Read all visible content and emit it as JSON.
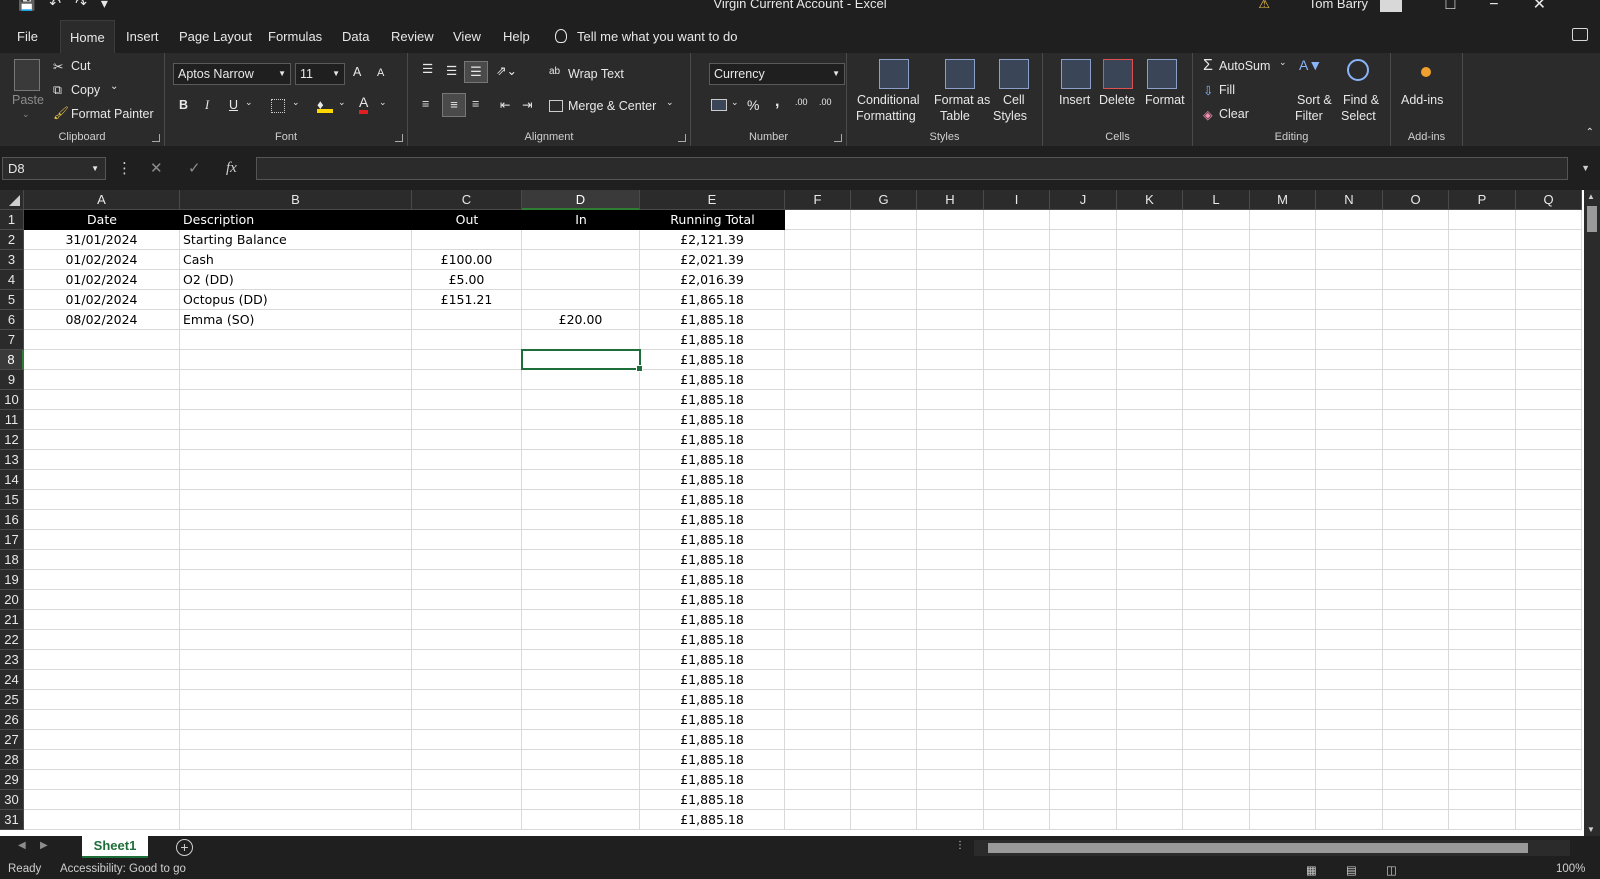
{
  "window": {
    "title": "Virgin Current Account  -  Excel",
    "user": "Tom Barry"
  },
  "menu": {
    "tabs": [
      "File",
      "Home",
      "Insert",
      "Page Layout",
      "Formulas",
      "Data",
      "Review",
      "View",
      "Help"
    ],
    "active": "Home",
    "tell_me": "Tell me what you want to do"
  },
  "ribbon": {
    "clipboard": {
      "label": "Clipboard",
      "paste": "Paste",
      "cut": "Cut",
      "copy": "Copy",
      "format_painter": "Format Painter"
    },
    "font": {
      "label": "Font",
      "name": "Aptos Narrow",
      "size": "11",
      "bold": "B",
      "italic": "I",
      "underline": "U",
      "grow": "A",
      "shrink": "A",
      "font_color_letter": "A"
    },
    "alignment": {
      "label": "Alignment",
      "wrap_text": "Wrap Text",
      "merge_center": "Merge & Center"
    },
    "number": {
      "label": "Number",
      "format": "Currency",
      "percent": "%",
      "comma": ",",
      "inc_dec": ".00",
      "dec_dec": ".00"
    },
    "styles": {
      "label": "Styles",
      "conditional": [
        "Conditional",
        "Formatting"
      ],
      "format_table": [
        "Format as",
        "Table"
      ],
      "cell_styles": [
        "Cell",
        "Styles"
      ]
    },
    "cells": {
      "label": "Cells",
      "insert": "Insert",
      "delete": "Delete",
      "format": "Format"
    },
    "editing": {
      "label": "Editing",
      "autosum": "AutoSum",
      "fill": "Fill",
      "clear": "Clear",
      "sort_filter": [
        "Sort &",
        "Filter"
      ],
      "find_select": [
        "Find &",
        "Select"
      ]
    },
    "addins": {
      "label": "Add-ins",
      "addins": "Add-ins"
    }
  },
  "formula_bar": {
    "name_box": "D8",
    "cancel": "✕",
    "enter": "✓",
    "fx": "fx",
    "value": ""
  },
  "grid": {
    "columns": [
      "A",
      "B",
      "C",
      "D",
      "E",
      "F",
      "G",
      "H",
      "I",
      "J",
      "K",
      "L",
      "M",
      "N",
      "O",
      "P",
      "Q"
    ],
    "selected_column": "D",
    "selected_row": 8,
    "headers": [
      "Date",
      "Description",
      "Out",
      "In",
      "Running Total"
    ],
    "rows": [
      [
        "31/01/2024",
        "Starting Balance",
        "",
        "",
        "£2,121.39"
      ],
      [
        "01/02/2024",
        "Cash",
        "£100.00",
        "",
        "£2,021.39"
      ],
      [
        "01/02/2024",
        "O2 (DD)",
        "£5.00",
        "",
        "£2,016.39"
      ],
      [
        "01/02/2024",
        "Octopus  (DD)",
        "£151.21",
        "",
        "£1,865.18"
      ],
      [
        "08/02/2024",
        "Emma (SO)",
        "",
        "£20.00",
        "£1,885.18"
      ],
      [
        "",
        "",
        "",
        "",
        "£1,885.18"
      ],
      [
        "",
        "",
        "",
        "",
        "£1,885.18"
      ],
      [
        "",
        "",
        "",
        "",
        "£1,885.18"
      ],
      [
        "",
        "",
        "",
        "",
        "£1,885.18"
      ],
      [
        "",
        "",
        "",
        "",
        "£1,885.18"
      ],
      [
        "",
        "",
        "",
        "",
        "£1,885.18"
      ],
      [
        "",
        "",
        "",
        "",
        "£1,885.18"
      ],
      [
        "",
        "",
        "",
        "",
        "£1,885.18"
      ],
      [
        "",
        "",
        "",
        "",
        "£1,885.18"
      ],
      [
        "",
        "",
        "",
        "",
        "£1,885.18"
      ],
      [
        "",
        "",
        "",
        "",
        "£1,885.18"
      ],
      [
        "",
        "",
        "",
        "",
        "£1,885.18"
      ],
      [
        "",
        "",
        "",
        "",
        "£1,885.18"
      ],
      [
        "",
        "",
        "",
        "",
        "£1,885.18"
      ],
      [
        "",
        "",
        "",
        "",
        "£1,885.18"
      ],
      [
        "",
        "",
        "",
        "",
        "£1,885.18"
      ],
      [
        "",
        "",
        "",
        "",
        "£1,885.18"
      ],
      [
        "",
        "",
        "",
        "",
        "£1,885.18"
      ],
      [
        "",
        "",
        "",
        "",
        "£1,885.18"
      ],
      [
        "",
        "",
        "",
        "",
        "£1,885.18"
      ],
      [
        "",
        "",
        "",
        "",
        "£1,885.18"
      ],
      [
        "",
        "",
        "",
        "",
        "£1,885.18"
      ],
      [
        "",
        "",
        "",
        "",
        "£1,885.18"
      ],
      [
        "",
        "",
        "",
        "",
        "£1,885.18"
      ],
      [
        "",
        "",
        "",
        "",
        "£1,885.18"
      ]
    ]
  },
  "sheets": {
    "tabs": [
      "Sheet1"
    ],
    "active": "Sheet1",
    "add": "+"
  },
  "status": {
    "ready": "Ready",
    "accessibility": "Accessibility: Good to go",
    "zoom": "100%"
  },
  "colors": {
    "accent": "#1e6e3a",
    "header_bg": "#000000",
    "ribbon_bg": "#2b2b2b"
  }
}
